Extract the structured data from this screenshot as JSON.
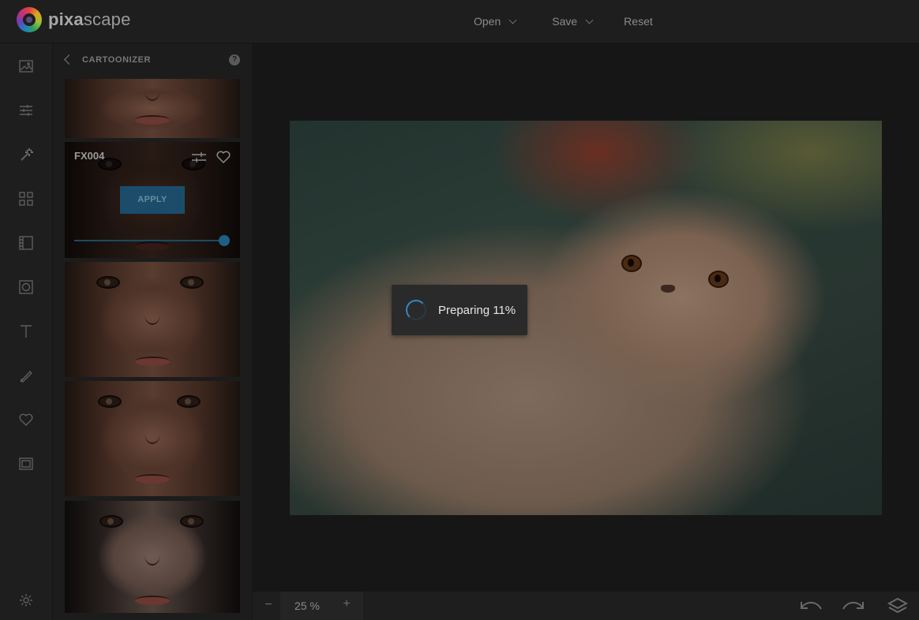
{
  "app": {
    "logo_part1": "pixa",
    "logo_part2": "scape"
  },
  "topnav": {
    "open": "Open",
    "save": "Save",
    "reset": "Reset"
  },
  "rail_icons": [
    "image-icon",
    "sliders-icon",
    "magic-wand-icon",
    "grid-icon",
    "film-icon",
    "frame-circle-icon",
    "text-icon",
    "brush-icon",
    "heart-icon",
    "frame-icon",
    "settings-icon"
  ],
  "panel": {
    "title": "CARTOONIZER",
    "active_effect": {
      "label": "FX004",
      "apply_label": "APPLY",
      "intensity": 1.0
    }
  },
  "canvas": {
    "loading_text": "Preparing 11%"
  },
  "bottombar": {
    "zoom_out": "−",
    "zoom_value": "25 %",
    "zoom_in": "+"
  },
  "colors": {
    "accent": "#2f8ac4",
    "apply_bg": "#1b4d6b"
  }
}
